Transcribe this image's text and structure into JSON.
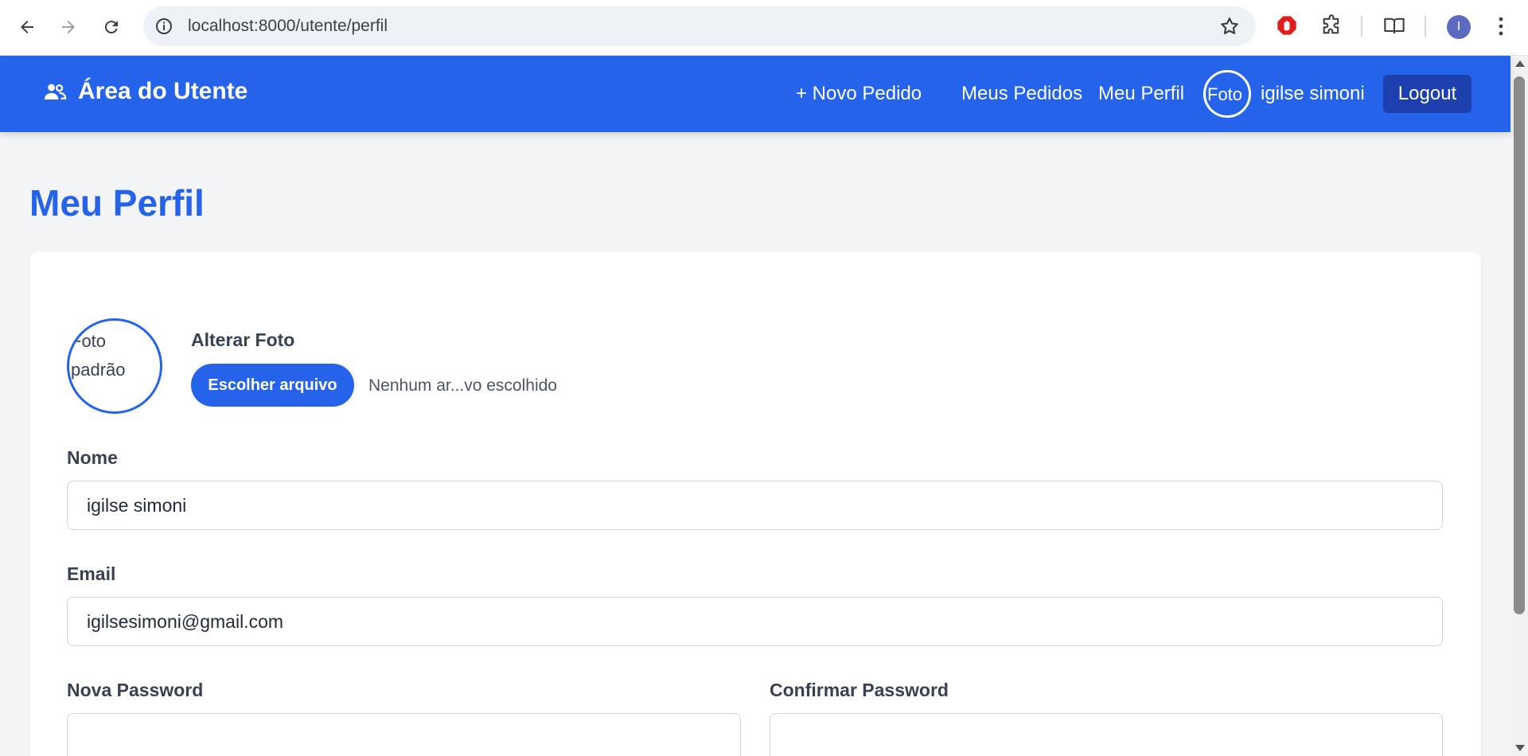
{
  "browser": {
    "url": "localhost:8000/utente/perfil",
    "profile_initial": "I"
  },
  "header": {
    "brand_title": "Área do Utente",
    "nav": {
      "new_request": "+ Novo Pedido",
      "my_requests": "Meus Pedidos",
      "my_profile": "Meu Perfil"
    },
    "avatar_alt": "Foto",
    "user_name": "igilse simoni",
    "logout_label": "Logout"
  },
  "page": {
    "title": "Meu Perfil",
    "photo": {
      "alt": "Foto padrão",
      "change_label": "Alterar Foto",
      "choose_button": "Escolher arquivo",
      "file_status": "Nenhum ar...vo escolhido"
    },
    "form": {
      "name_label": "Nome",
      "name_value": "igilse simoni",
      "email_label": "Email",
      "email_value": "igilsesimoni@gmail.com",
      "new_password_label": "Nova Password",
      "new_password_value": "",
      "confirm_password_label": "Confirmar Password",
      "confirm_password_value": ""
    }
  },
  "colors": {
    "primary": "#2563eb",
    "logout_bg": "#1e40af",
    "page_bg": "#f3f4f6"
  }
}
